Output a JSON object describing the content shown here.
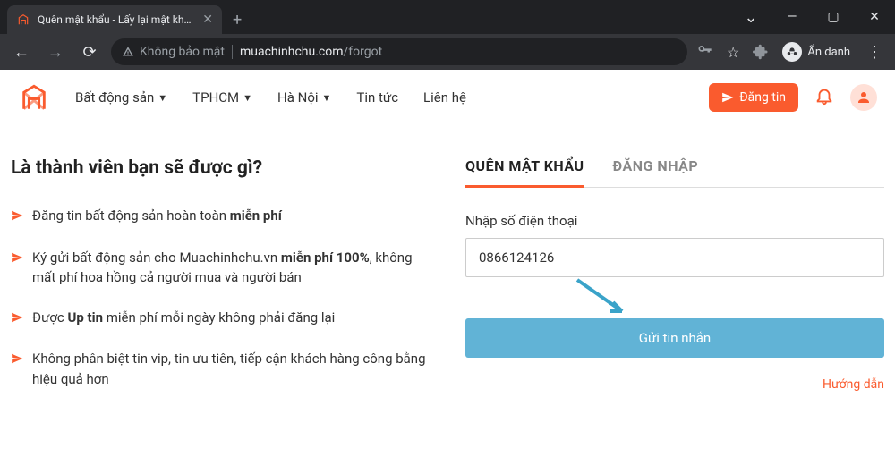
{
  "browser": {
    "tab_title": "Quên mật khẩu - Lấy lại mật khẩu",
    "window_controls": {
      "minimize": "—",
      "maximize": "▢",
      "close": "✕",
      "dropdown": "⌄"
    },
    "newtab": "+",
    "nav": {
      "back": "←",
      "forward": "→",
      "reload": "⟳"
    },
    "security_label": "Không bảo mật",
    "url_host": "muachinhchu.com",
    "url_path": "/forgot",
    "incognito_label": "Ẩn danh"
  },
  "site_nav": {
    "items": [
      {
        "label": "Bất động sản",
        "dropdown": true
      },
      {
        "label": "TPHCM",
        "dropdown": true
      },
      {
        "label": "Hà Nội",
        "dropdown": true
      },
      {
        "label": "Tin tức",
        "dropdown": false
      },
      {
        "label": "Liên hệ",
        "dropdown": false
      }
    ],
    "post_button": "Đăng tin"
  },
  "left_panel": {
    "heading": "Là thành viên bạn sẽ được gì?",
    "benefits": [
      {
        "pre": "Đăng tin bất động sản hoàn toàn ",
        "bold": "miễn phí",
        "post": ""
      },
      {
        "pre": "Ký gửi bất động sản cho Muachinhchu.vn ",
        "bold": "miễn phí 100%",
        "post": ", không mất phí hoa hồng cả người mua và người bán"
      },
      {
        "pre": "Được ",
        "bold": "Up tin",
        "post": " miễn phí mỗi ngày không phải đăng lại"
      },
      {
        "pre": "Không phân biệt tin vip, tin ưu tiên, tiếp cận khách hàng công bằng hiệu quả hơn",
        "bold": "",
        "post": ""
      }
    ]
  },
  "right_panel": {
    "tab_forgot": "QUÊN MẬT KHẨU",
    "tab_login": "ĐĂNG NHẬP",
    "phone_label": "Nhập số điện thoại",
    "phone_value": "0866124126",
    "submit": "Gửi tin nhắn",
    "guide": "Hướng dẫn"
  },
  "colors": {
    "accent": "#fa5b2e",
    "button_blue": "#61b3d6"
  }
}
